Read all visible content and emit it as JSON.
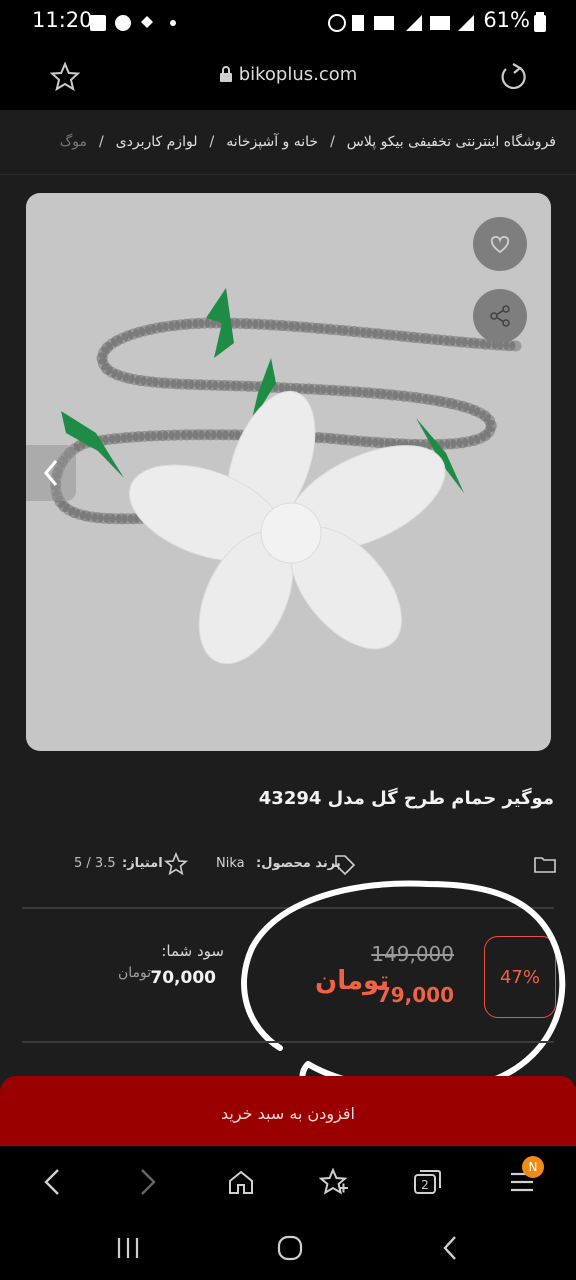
{
  "status": {
    "time": "11:20",
    "battery": "61%"
  },
  "browser": {
    "url": "bikoplus.com"
  },
  "breadcrumb": {
    "items": [
      "فروشگاه اینترنتی تخفیفی بیکو پلاس",
      "خانه و آشپزخانه",
      "لوازم کاربردی",
      "موگ"
    ],
    "separator": "/"
  },
  "product": {
    "title": "موگیر حمام طرح گل مدل 43294",
    "brand_label": "برند محصول:",
    "brand": "Nika",
    "rating_label": "امتیاز:",
    "rating": "5 / 3.5"
  },
  "price": {
    "discount": "47%",
    "old": "149,000",
    "new": "79,000",
    "currency": "تومان",
    "profit_label": "سود شما:",
    "profit": "70,000",
    "profit_currency": "تومان"
  },
  "cart": {
    "label": "افزودن به سبد خرید"
  },
  "nav": {
    "badge": "N",
    "tabs_count": "2"
  },
  "colors": {
    "accent": "#f06246",
    "cart": "#9a0000",
    "badge": "#f28a17"
  }
}
